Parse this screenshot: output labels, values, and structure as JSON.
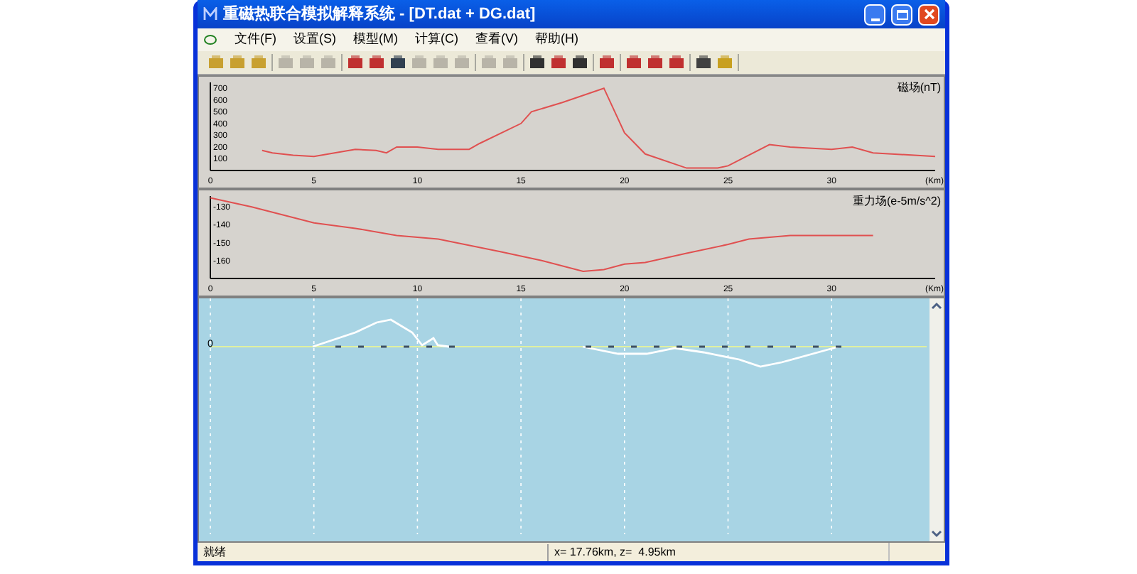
{
  "window": {
    "title": "重磁热联合模拟解释系统 - [DT.dat + DG.dat]"
  },
  "menu": [
    {
      "label": "文件(F)"
    },
    {
      "label": "设置(S)"
    },
    {
      "label": "模型(M)"
    },
    {
      "label": "计算(C)"
    },
    {
      "label": "查看(V)"
    },
    {
      "label": "帮助(H)"
    }
  ],
  "toolbar": [
    [
      {
        "disabled": false
      },
      {
        "disabled": false
      },
      {
        "disabled": false
      }
    ],
    [
      {
        "disabled": true
      },
      {
        "disabled": true
      },
      {
        "disabled": true
      }
    ],
    [
      {
        "disabled": false
      },
      {
        "disabled": false
      },
      {
        "disabled": false
      },
      {
        "disabled": true
      },
      {
        "disabled": true
      },
      {
        "disabled": true
      }
    ],
    [
      {
        "disabled": true
      },
      {
        "disabled": true
      }
    ],
    [
      {
        "disabled": false
      },
      {
        "disabled": false
      },
      {
        "disabled": false
      }
    ],
    [
      {
        "disabled": false
      }
    ],
    [
      {
        "disabled": false
      },
      {
        "disabled": false
      },
      {
        "disabled": false
      }
    ],
    [
      {
        "disabled": false
      },
      {
        "disabled": false
      }
    ]
  ],
  "magnetic_panel": {
    "chart_data": {
      "type": "line",
      "title": "磁场(nT)",
      "xlabel": "(Km)",
      "xlim": [
        0,
        35
      ],
      "ylim": [
        0,
        750
      ],
      "xticks": [
        0,
        5,
        10,
        15,
        20,
        25,
        30
      ],
      "yticks": [
        100,
        200,
        300,
        400,
        500,
        600,
        700
      ],
      "series": [
        {
          "color": "#e05050",
          "x": [
            2.5,
            3,
            4,
            5,
            6,
            7,
            8,
            8.5,
            9,
            10,
            11,
            12.5,
            13,
            15,
            15.5,
            17,
            19,
            20,
            21,
            23,
            24.5,
            25,
            27,
            28,
            30,
            31,
            32,
            35
          ],
          "values": [
            170,
            150,
            130,
            120,
            150,
            180,
            170,
            150,
            200,
            200,
            180,
            180,
            230,
            400,
            500,
            580,
            700,
            320,
            140,
            20,
            20,
            40,
            220,
            200,
            180,
            200,
            150,
            120
          ]
        }
      ]
    }
  },
  "gravity_panel": {
    "chart_data": {
      "type": "line",
      "title": "重力场(e-5m/s^2)",
      "xlabel": "(Km)",
      "xlim": [
        0,
        35
      ],
      "ylim": [
        -170,
        -124
      ],
      "xticks": [
        0,
        5,
        10,
        15,
        20,
        25,
        30
      ],
      "yticks": [
        -130,
        -140,
        -150,
        -160
      ],
      "series": [
        {
          "color": "#e05050",
          "x": [
            0,
            2,
            5,
            7,
            9,
            11,
            14,
            16,
            18,
            19,
            20,
            21,
            23,
            25,
            26,
            28,
            29,
            32
          ],
          "values": [
            -125,
            -130,
            -139,
            -142,
            -146,
            -148,
            -155,
            -160,
            -166,
            -165,
            -162,
            -161,
            -156,
            -151,
            -148,
            -146,
            -146,
            -146
          ]
        }
      ]
    }
  },
  "model_panel": {
    "zero_label": "0"
  },
  "status_bar": {
    "state": "就绪",
    "coords": "x= 17.76km, z=  4.95km"
  }
}
